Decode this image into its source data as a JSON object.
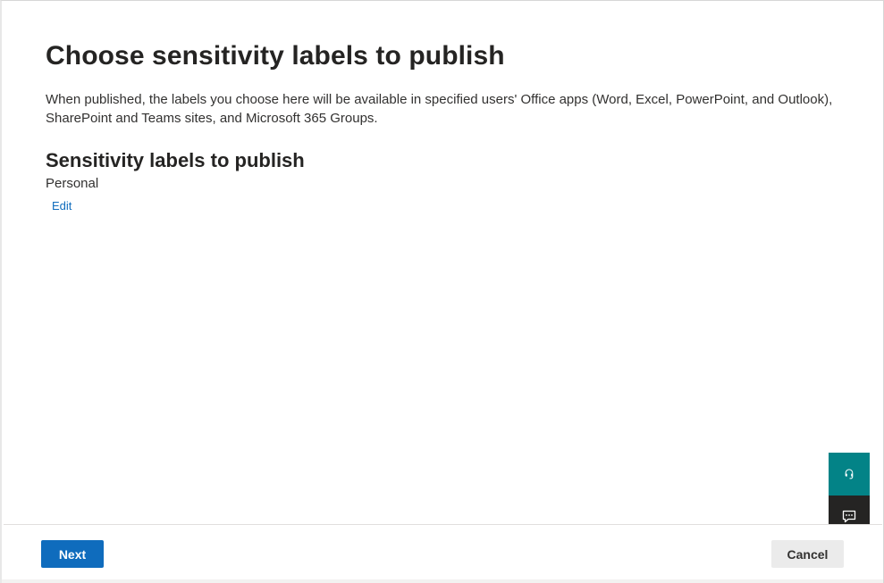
{
  "page": {
    "title": "Choose sensitivity labels to publish",
    "description": "When published, the labels you choose here will be available in specified users' Office apps (Word, Excel, PowerPoint, and Outlook), SharePoint and Teams sites, and Microsoft 365 Groups."
  },
  "labels_section": {
    "heading": "Sensitivity labels to publish",
    "value": "Personal",
    "edit_label": "Edit"
  },
  "footer": {
    "next_label": "Next",
    "cancel_label": "Cancel"
  },
  "floating_actions": {
    "help_icon": "headset-icon",
    "feedback_icon": "feedback-icon"
  },
  "colors": {
    "primary": "#0f6cbd",
    "help_bg": "#038387",
    "feedback_bg": "#252423"
  }
}
